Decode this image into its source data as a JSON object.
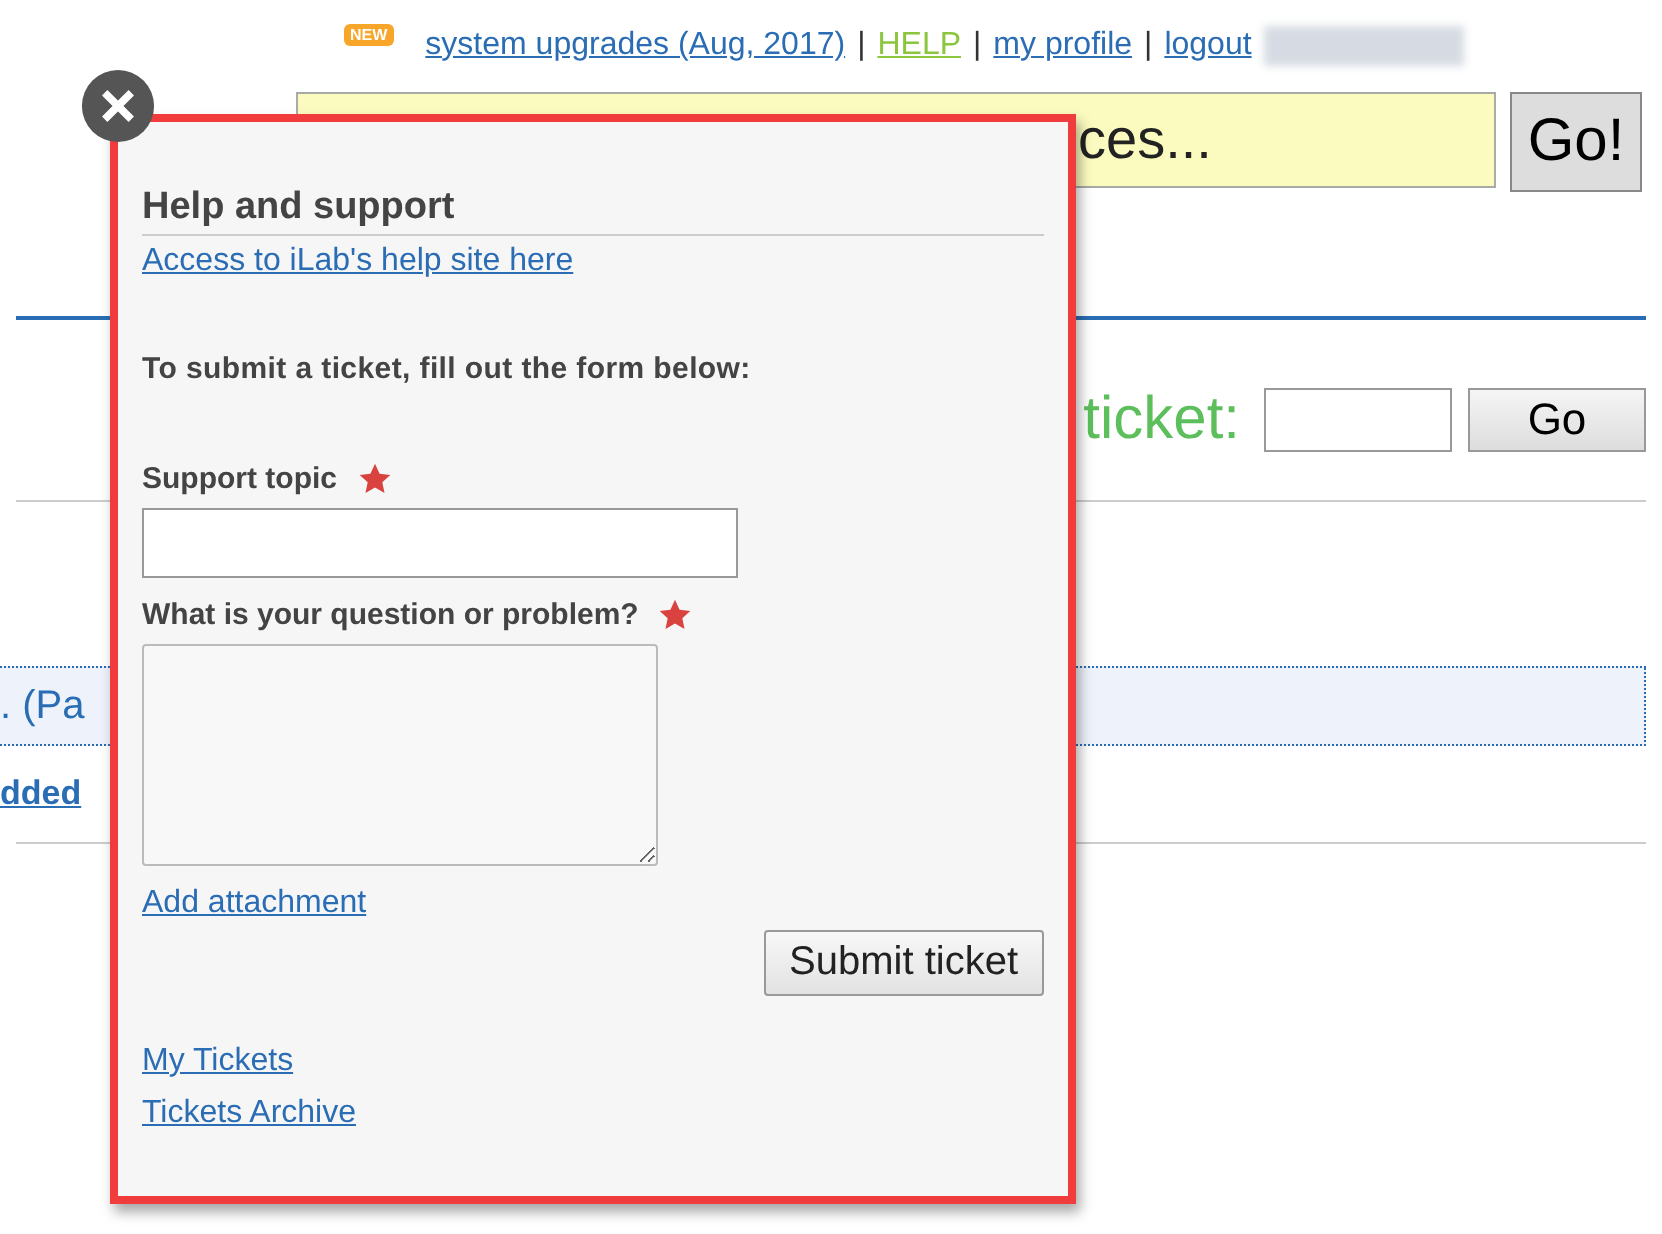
{
  "top_nav": {
    "badge": "NEW",
    "links": [
      {
        "label": "system upgrades (Aug, 2017)",
        "selected": false
      },
      {
        "label": "HELP",
        "selected": true
      },
      {
        "label": "my profile",
        "selected": false
      },
      {
        "label": "logout",
        "selected": false
      }
    ],
    "separators": [
      "|",
      "|",
      "|"
    ]
  },
  "search": {
    "visible_text": "ces...",
    "button": "Go!"
  },
  "ticket_lookup": {
    "label": "ticket:",
    "button": "Go"
  },
  "listing": {
    "row_text": ". (Pa",
    "link": "dded"
  },
  "help_popup": {
    "title": "Help and support",
    "site_link": "Access to iLab's help site here",
    "intro": "To submit a ticket, fill out the form below:",
    "fields": [
      {
        "label": "Support topic",
        "required": true,
        "kind": "input"
      },
      {
        "label": "What is your question or problem?",
        "required": true,
        "kind": "textarea"
      }
    ],
    "attachment_link": "Add attachment",
    "submit_button": "Submit ticket",
    "links": [
      "My Tickets",
      "Tickets Archive"
    ]
  }
}
